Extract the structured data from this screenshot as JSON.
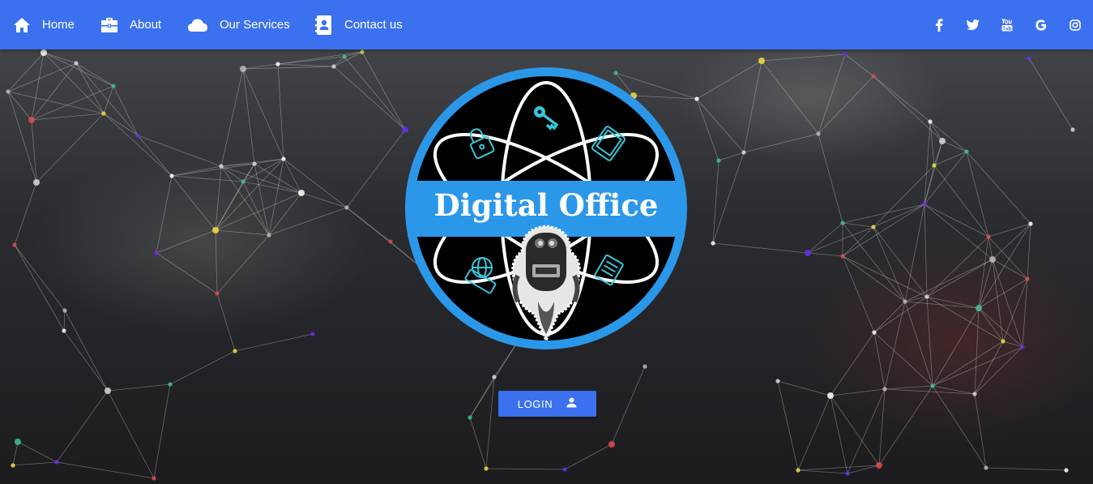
{
  "nav": {
    "items": [
      {
        "label": "Home",
        "icon": "home-icon"
      },
      {
        "label": "About",
        "icon": "briefcase-icon"
      },
      {
        "label": "Our Services",
        "icon": "cloud-icon"
      },
      {
        "label": "Contact us",
        "icon": "contact-card-icon"
      }
    ],
    "social": [
      "facebook-icon",
      "twitter-icon",
      "youtube-icon",
      "google-icon",
      "instagram-icon"
    ]
  },
  "logo": {
    "text": "Digital Office",
    "icons": [
      "key-icon",
      "lock-icon",
      "tablet-icon",
      "globe-icon",
      "document-icon",
      "robot-icon"
    ]
  },
  "login": {
    "label": "LOGIN",
    "icon": "user-icon"
  },
  "colors": {
    "navbar": "#3b71ee",
    "button": "#3b71ee",
    "logo_ring": "#2b97e9",
    "logo_cyan": "#38c6d9"
  }
}
